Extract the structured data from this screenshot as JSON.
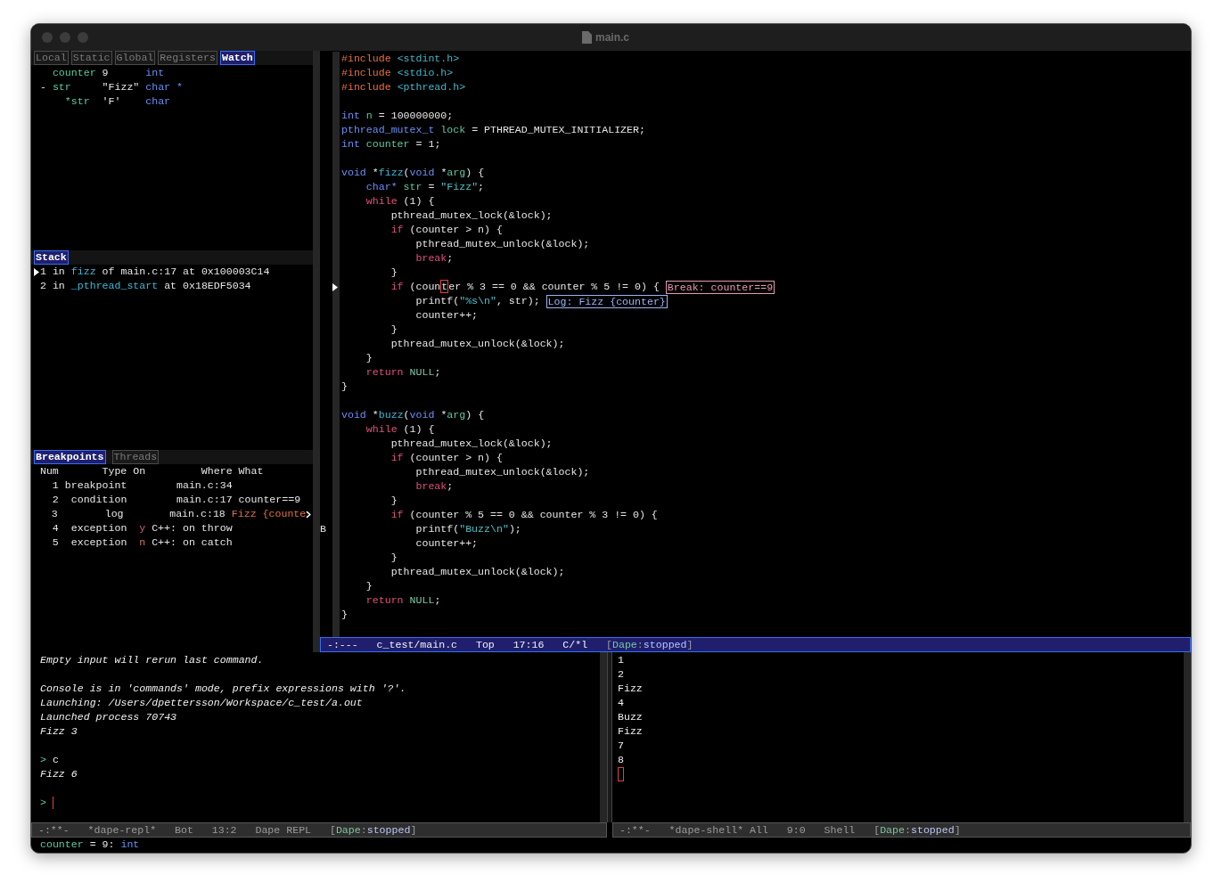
{
  "window": {
    "title": "main.c"
  },
  "locals": {
    "tabs": [
      {
        "label": "Local",
        "selected": false
      },
      {
        "label": "Static",
        "selected": false
      },
      {
        "label": "Global",
        "selected": false
      },
      {
        "label": "Registers",
        "selected": false
      },
      {
        "label": "Watch",
        "selected": true
      }
    ],
    "rows": [
      {
        "name": "counter",
        "value": "9",
        "type": "int"
      },
      {
        "toggle": "-",
        "name": "str",
        "value": "\"Fizz\"",
        "type": "char *",
        "children": [
          {
            "name": "*str",
            "value": "'F'",
            "type": "char"
          }
        ]
      }
    ]
  },
  "stack": {
    "title": "Stack",
    "frames": [
      {
        "selected": true,
        "tokens": [
          {
            "kind": "plain",
            "text": "1 in "
          },
          {
            "kind": "func",
            "text": "fizz"
          },
          {
            "kind": "plain",
            "text": " of main.c:17 at 0x100003C14"
          }
        ]
      },
      {
        "selected": false,
        "tokens": [
          {
            "kind": "plain",
            "text": "2 in "
          },
          {
            "kind": "func",
            "text": "_pthread_start"
          },
          {
            "kind": "plain",
            "text": " at 0x18EDF5034"
          }
        ]
      }
    ]
  },
  "breakpoints": {
    "tabs": [
      {
        "label": "Breakpoints",
        "selected": true
      },
      {
        "label": "Threads",
        "selected": false
      }
    ],
    "columns": [
      "Num",
      "Type",
      "On",
      "Where",
      "What"
    ],
    "rows": [
      {
        "num": "1",
        "type": "breakpoint",
        "where": "main.c:34",
        "overflow": false
      },
      {
        "num": "2",
        "type": "condition",
        "where": "main.c:17",
        "what": {
          "kind": "condition",
          "text": "counter==9"
        },
        "overflow": false
      },
      {
        "num": "3",
        "type": "log",
        "where": "main.c:18",
        "what": {
          "kind": "log",
          "text": "Fizz {counte"
        },
        "overflow": true
      },
      {
        "num": "4",
        "type": "exception",
        "on": "y",
        "enabled": true,
        "where": "C++: on throw",
        "overflow": false
      },
      {
        "num": "5",
        "type": "exception",
        "on": "n",
        "enabled": false,
        "where": "C++: on catch",
        "overflow": false
      }
    ]
  },
  "editor": {
    "lines": [
      {
        "kind": "code",
        "tokens": [
          {
            "kind": "pp",
            "text": "#include"
          },
          {
            "kind": "hdr",
            "text": " <stdint.h>"
          }
        ]
      },
      {
        "kind": "code",
        "tokens": [
          {
            "kind": "pp",
            "text": "#include"
          },
          {
            "kind": "hdr",
            "text": " <stdio.h>"
          }
        ]
      },
      {
        "kind": "code",
        "tokens": [
          {
            "kind": "pp",
            "text": "#include"
          },
          {
            "kind": "hdr",
            "text": " <pthread.h>"
          }
        ]
      },
      {
        "kind": "blank"
      },
      {
        "kind": "code",
        "tokens": [
          {
            "kind": "type",
            "text": "int"
          },
          {
            "kind": "var",
            "text": " n"
          },
          {
            "kind": "plain",
            "text": " = 100000000;"
          }
        ]
      },
      {
        "kind": "code",
        "tokens": [
          {
            "kind": "type",
            "text": "pthread_mutex_t"
          },
          {
            "kind": "var",
            "text": " lock"
          },
          {
            "kind": "plain",
            "text": " = PTHREAD_MUTEX_INITIALIZER;"
          }
        ]
      },
      {
        "kind": "code",
        "tokens": [
          {
            "kind": "type",
            "text": "int"
          },
          {
            "kind": "var",
            "text": " counter"
          },
          {
            "kind": "plain",
            "text": " = 1;"
          }
        ]
      },
      {
        "kind": "blank"
      },
      {
        "kind": "code",
        "tokens": [
          {
            "kind": "type",
            "text": "void"
          },
          {
            "kind": "plain",
            "text": " *"
          },
          {
            "kind": "func",
            "text": "fizz"
          },
          {
            "kind": "plain",
            "text": "("
          },
          {
            "kind": "type",
            "text": "void"
          },
          {
            "kind": "plain",
            "text": " *"
          },
          {
            "kind": "var",
            "text": "arg"
          },
          {
            "kind": "plain",
            "text": ") {"
          }
        ]
      },
      {
        "kind": "code",
        "tokens": [
          {
            "kind": "type",
            "text": "    char*"
          },
          {
            "kind": "var",
            "text": " str"
          },
          {
            "kind": "plain",
            "text": " = "
          },
          {
            "kind": "str",
            "text": "\"Fizz\""
          },
          {
            "kind": "plain",
            "text": ";"
          }
        ]
      },
      {
        "kind": "code",
        "tokens": [
          {
            "kind": "kw",
            "text": "    while"
          },
          {
            "kind": "plain",
            "text": " (1) {"
          }
        ]
      },
      {
        "kind": "code",
        "tokens": [
          {
            "kind": "plain",
            "text": "        pthread_mutex_lock(&lock);"
          }
        ]
      },
      {
        "kind": "code",
        "tokens": [
          {
            "kind": "kw",
            "text": "        if"
          },
          {
            "kind": "plain",
            "text": " (counter > n) {"
          }
        ]
      },
      {
        "kind": "code",
        "tokens": [
          {
            "kind": "plain",
            "text": "            pthread_mutex_unlock(&lock);"
          }
        ]
      },
      {
        "kind": "code",
        "tokens": [
          {
            "kind": "kw",
            "text": "            break"
          },
          {
            "kind": "plain",
            "text": ";"
          }
        ]
      },
      {
        "kind": "code",
        "tokens": [
          {
            "kind": "plain",
            "text": "        }"
          }
        ]
      },
      {
        "kind": "code",
        "current": true,
        "tokens": [
          {
            "kind": "kw",
            "text": "        if"
          },
          {
            "kind": "plain",
            "text": " (coun"
          },
          {
            "kind": "cursor",
            "text": "t"
          },
          {
            "kind": "plain",
            "text": "er % 3 == 0 && counter % 5 != 0) {"
          },
          {
            "kind": "break",
            "text": "Break: counter==9"
          }
        ]
      },
      {
        "kind": "code",
        "tokens": [
          {
            "kind": "plain",
            "text": "            printf("
          },
          {
            "kind": "str",
            "text": "\"%s\\n\""
          },
          {
            "kind": "plain",
            "text": ", str);"
          },
          {
            "kind": "log",
            "text": "Log: Fizz {counter}"
          }
        ]
      },
      {
        "kind": "code",
        "tokens": [
          {
            "kind": "plain",
            "text": "            counter++;"
          }
        ]
      },
      {
        "kind": "code",
        "tokens": [
          {
            "kind": "plain",
            "text": "        }"
          }
        ]
      },
      {
        "kind": "code",
        "tokens": [
          {
            "kind": "plain",
            "text": "        pthread_mutex_unlock(&lock);"
          }
        ]
      },
      {
        "kind": "code",
        "tokens": [
          {
            "kind": "plain",
            "text": "    }"
          }
        ]
      },
      {
        "kind": "code",
        "tokens": [
          {
            "kind": "kw",
            "text": "    return"
          },
          {
            "kind": "const",
            "text": " NULL"
          },
          {
            "kind": "plain",
            "text": ";"
          }
        ]
      },
      {
        "kind": "code",
        "tokens": [
          {
            "kind": "plain",
            "text": "}"
          }
        ]
      },
      {
        "kind": "blank"
      },
      {
        "kind": "code",
        "tokens": [
          {
            "kind": "type",
            "text": "void"
          },
          {
            "kind": "plain",
            "text": " *"
          },
          {
            "kind": "func",
            "text": "buzz"
          },
          {
            "kind": "plain",
            "text": "("
          },
          {
            "kind": "type",
            "text": "void"
          },
          {
            "kind": "plain",
            "text": " *"
          },
          {
            "kind": "var",
            "text": "arg"
          },
          {
            "kind": "plain",
            "text": ") {"
          }
        ]
      },
      {
        "kind": "code",
        "tokens": [
          {
            "kind": "kw",
            "text": "    while"
          },
          {
            "kind": "plain",
            "text": " (1) {"
          }
        ]
      },
      {
        "kind": "code",
        "tokens": [
          {
            "kind": "plain",
            "text": "        pthread_mutex_lock(&lock);"
          }
        ]
      },
      {
        "kind": "code",
        "tokens": [
          {
            "kind": "kw",
            "text": "        if"
          },
          {
            "kind": "plain",
            "text": " (counter > n) {"
          }
        ]
      },
      {
        "kind": "code",
        "tokens": [
          {
            "kind": "plain",
            "text": "            pthread_mutex_unlock(&lock);"
          }
        ]
      },
      {
        "kind": "code",
        "tokens": [
          {
            "kind": "kw",
            "text": "            break"
          },
          {
            "kind": "plain",
            "text": ";"
          }
        ]
      },
      {
        "kind": "code",
        "tokens": [
          {
            "kind": "plain",
            "text": "        }"
          }
        ]
      },
      {
        "kind": "code",
        "tokens": [
          {
            "kind": "kw",
            "text": "        if"
          },
          {
            "kind": "plain",
            "text": " (counter % 5 == 0 && counter % 3 != 0) {"
          }
        ]
      },
      {
        "kind": "code",
        "margin": "B",
        "tokens": [
          {
            "kind": "plain",
            "text": "            printf("
          },
          {
            "kind": "str",
            "text": "\"Buzz\\n\""
          },
          {
            "kind": "plain",
            "text": ");"
          }
        ]
      },
      {
        "kind": "code",
        "tokens": [
          {
            "kind": "plain",
            "text": "            counter++;"
          }
        ]
      },
      {
        "kind": "code",
        "tokens": [
          {
            "kind": "plain",
            "text": "        }"
          }
        ]
      },
      {
        "kind": "code",
        "tokens": [
          {
            "kind": "plain",
            "text": "        pthread_mutex_unlock(&lock);"
          }
        ]
      },
      {
        "kind": "code",
        "tokens": [
          {
            "kind": "plain",
            "text": "    }"
          }
        ]
      },
      {
        "kind": "code",
        "tokens": [
          {
            "kind": "kw",
            "text": "    return"
          },
          {
            "kind": "const",
            "text": " NULL"
          },
          {
            "kind": "plain",
            "text": ";"
          }
        ]
      },
      {
        "kind": "code",
        "tokens": [
          {
            "kind": "plain",
            "text": "}"
          }
        ]
      }
    ],
    "mode_line": {
      "active": true,
      "segments": [
        "-:---",
        "c_test/main.c",
        "Top",
        "17:16",
        "C/*l"
      ],
      "status": [
        {
          "kind": "br",
          "text": "["
        },
        {
          "kind": "name",
          "text": "Dape"
        },
        {
          "kind": "sep",
          "text": ":"
        },
        {
          "kind": "state",
          "text": "stopped"
        },
        {
          "kind": "br",
          "text": "]"
        }
      ]
    }
  },
  "repl": {
    "lines": [
      {
        "kind": "message",
        "text": "Empty input will rerun last command."
      },
      {
        "kind": "blank"
      },
      {
        "kind": "message",
        "text": "Console is in 'commands' mode, prefix expressions with '?'."
      },
      {
        "kind": "message",
        "text": "Launching: /Users/dpettersson/Workspace/c_test/a.out"
      },
      {
        "kind": "message",
        "text": "Launched process 70743"
      },
      {
        "kind": "message",
        "text": "Fizz 3"
      },
      {
        "kind": "blank"
      },
      {
        "kind": "input",
        "prompt": ">",
        "text": "c",
        "cursor": false
      },
      {
        "kind": "message",
        "text": "Fizz 6"
      },
      {
        "kind": "blank"
      },
      {
        "kind": "input",
        "prompt": ">",
        "cursor": true
      }
    ],
    "mode_line": {
      "active": false,
      "segments": [
        "-:**-",
        "*dape-repl*",
        "Bot",
        "13:2",
        "Dape REPL"
      ],
      "status": [
        {
          "kind": "br",
          "text": "["
        },
        {
          "kind": "name",
          "text": "Dape"
        },
        {
          "kind": "sep",
          "text": ":"
        },
        {
          "kind": "state",
          "text": "stopped"
        },
        {
          "kind": "br",
          "text": "]"
        }
      ]
    }
  },
  "shell": {
    "lines": [
      "1",
      "2",
      "Fizz",
      "4",
      "Buzz",
      "Fizz",
      "7",
      "8"
    ],
    "cursor": true,
    "mode_line": {
      "active": false,
      "segments": [
        "-:**-",
        "*dape-shell* All",
        "9:0",
        "Shell"
      ],
      "status": [
        {
          "kind": "br",
          "text": "["
        },
        {
          "kind": "name",
          "text": "Dape"
        },
        {
          "kind": "sep",
          "text": ":"
        },
        {
          "kind": "state",
          "text": "stopped"
        },
        {
          "kind": "br",
          "text": "]"
        }
      ]
    }
  },
  "echo_area": {
    "tokens": [
      {
        "kind": "var",
        "text": "counter"
      },
      {
        "kind": "plain",
        "text": " = 9: "
      },
      {
        "kind": "type",
        "text": "int"
      }
    ]
  }
}
